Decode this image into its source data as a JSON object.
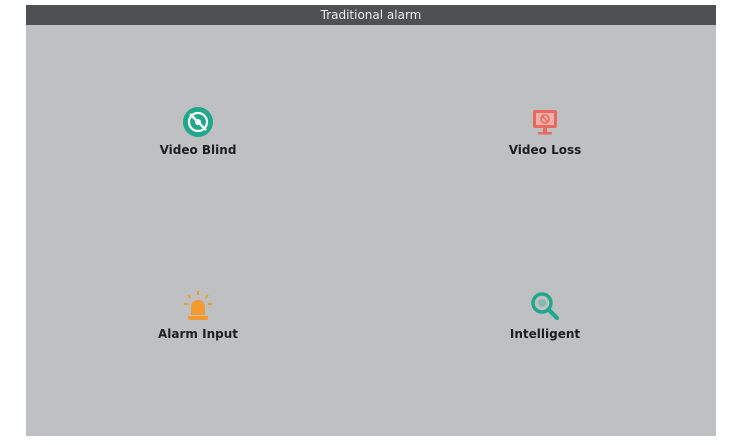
{
  "window": {
    "title": "Traditional alarm"
  },
  "tiles": [
    {
      "label": "Video Blind",
      "icon": "video-blind-icon",
      "color": "#1fa88c"
    },
    {
      "label": "Video Loss",
      "icon": "video-loss-icon",
      "color": "#e86a5e"
    },
    {
      "label": "Alarm Input",
      "icon": "alarm-siren-icon",
      "color": "#f39a2e"
    },
    {
      "label": "Intelligent",
      "icon": "magnifier-icon",
      "color": "#1fa88c"
    }
  ],
  "colors": {
    "panel_bg": "#bfc0c1",
    "titlebar_bg": "#4e5052"
  }
}
